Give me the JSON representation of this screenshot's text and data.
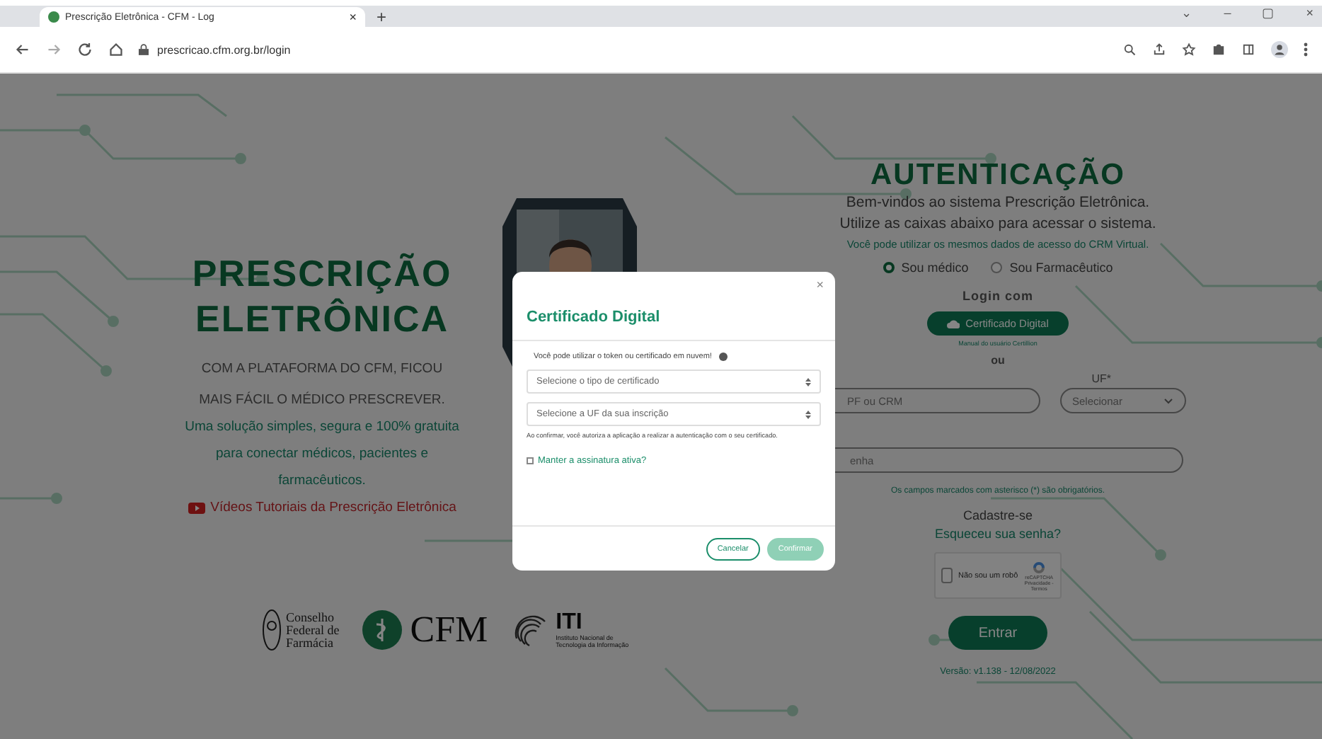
{
  "browser": {
    "tab": {
      "title": "Prescrição Eletrônica - CFM - Log",
      "close": "×"
    },
    "new_tab": "+",
    "window_controls": [
      "⌄",
      "–",
      "▢",
      "×"
    ],
    "url": "prescricao.cfm.org.br/login"
  },
  "left": {
    "title_lines": [
      "PRESCRIÇÃO",
      "ELETRÔNICA"
    ],
    "tagline_lines": [
      "COM A PLATAFORMA DO CFM, FICOU",
      "MAIS FÁCIL O MÉDICO PRESCREVER."
    ],
    "description": "Uma solução simples, segura e 100% gratuita para conectar médicos, pacientes e farmacêuticos.",
    "video_link": "Vídeos Tutoriais da Prescrição Eletrônica"
  },
  "logos": {
    "cff_lines": [
      "Conselho",
      "Federal de",
      "Farmácia"
    ],
    "cfm": "CFM",
    "iti": "ITI",
    "iti_sub_lines": [
      "Instituto Nacional de",
      "Tecnologia da Informação"
    ]
  },
  "auth": {
    "title": "AUTENTICAÇÃO",
    "intro_lines": [
      "Bem-vindos ao sistema Prescrição Eletrônica.",
      "Utilize as caixas abaixo para acessar o sistema."
    ],
    "crm_note": "Você pode utilizar os mesmos dados de acesso do CRM Virtual.",
    "roles": [
      {
        "label": "Sou médico",
        "selected": true
      },
      {
        "label": "Sou Farmacêutico",
        "selected": false
      }
    ],
    "login_with": "Login com",
    "certificate_button": "Certificado Digital",
    "manual_link": "Manual do usuário Certillion",
    "or": "ou",
    "uf_label": "UF*",
    "cpf_placeholder": "PF ou CRM",
    "uf_select": "Selecionar",
    "password_placeholder": "enha",
    "required_note": "Os campos marcados com asterisco (*) são obrigatórios.",
    "register_link": "Cadastre-se",
    "forgot_link": "Esqueceu sua senha?",
    "captcha": {
      "label": "Não sou um robô",
      "brand": "reCAPTCHA",
      "links": "Privacidade - Termos",
      "checked": false
    },
    "submit": "Entrar",
    "version": "Versão: v1.138 - 12/08/2022"
  },
  "modal": {
    "title": "Certificado Digital",
    "close": "×",
    "info": "Você pode utilizar o token ou certificado em nuvem!",
    "selects": [
      "Selecione o tipo de certificado",
      "Selecione a UF da sua inscrição"
    ],
    "consent": "Ao confirmar, você autoriza a aplicação a realizar a autenticação com o seu certificado.",
    "keep_signature": {
      "label": "Manter a assinatura ativa?",
      "checked": false
    },
    "buttons": [
      {
        "label": "Cancelar",
        "kind": "secondary"
      },
      {
        "label": "Confirmar",
        "kind": "primary"
      }
    ]
  }
}
